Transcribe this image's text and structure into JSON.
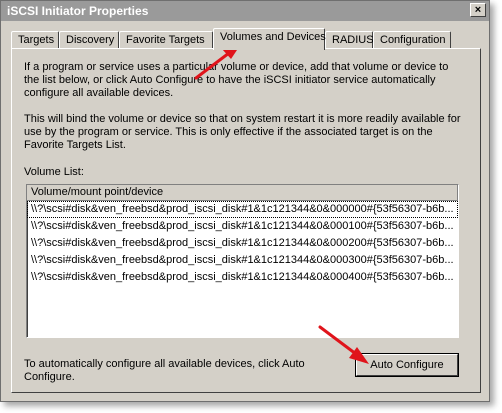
{
  "window": {
    "title": "iSCSI Initiator Properties",
    "close_glyph": "×"
  },
  "tabs": [
    {
      "label": "Targets"
    },
    {
      "label": "Discovery"
    },
    {
      "label": "Favorite Targets"
    },
    {
      "label": "Volumes and Devices"
    },
    {
      "label": "RADIUS"
    },
    {
      "label": "Configuration"
    }
  ],
  "active_tab": "Volumes and Devices",
  "panel": {
    "intro": "If a program or service uses a particular volume or device, add that volume or device to the list below, or click Auto Configure to have the iSCSI initiator service automatically configure all available devices.",
    "bind_note": "This will bind the volume or device so that on system restart it is more readily available for use by the program or service.  This is only effective if the associated target is on the Favorite Targets List.",
    "volume_list_label": "Volume List:",
    "list_header": "Volume/mount point/device",
    "volumes": [
      "\\\\?\\scsi#disk&ven_freebsd&prod_iscsi_disk#1&1c121344&0&000000#{53f56307-b6b...",
      "\\\\?\\scsi#disk&ven_freebsd&prod_iscsi_disk#1&1c121344&0&000100#{53f56307-b6b...",
      "\\\\?\\scsi#disk&ven_freebsd&prod_iscsi_disk#1&1c121344&0&000200#{53f56307-b6b...",
      "\\\\?\\scsi#disk&ven_freebsd&prod_iscsi_disk#1&1c121344&0&000300#{53f56307-b6b...",
      "\\\\?\\scsi#disk&ven_freebsd&prod_iscsi_disk#1&1c121344&0&000400#{53f56307-b6b..."
    ],
    "auto_config_text": "To automatically configure all available devices, click Auto Configure.",
    "auto_config_button": "Auto Configure"
  },
  "colors": {
    "annotation_arrow": "#e0141b",
    "dialog_face": "#d4d0c8",
    "title_bar": "#9a9a9a"
  }
}
